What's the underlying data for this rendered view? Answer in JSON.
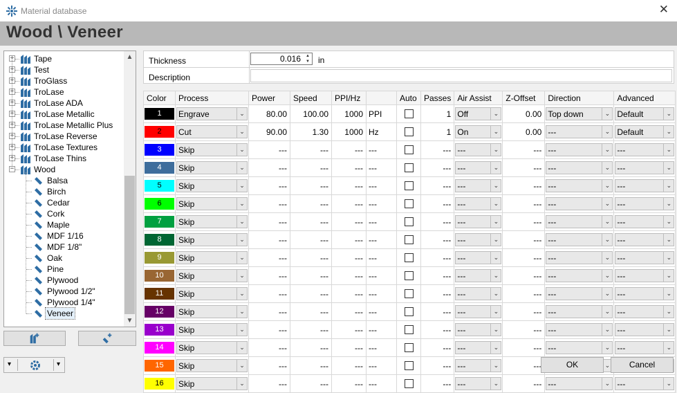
{
  "window": {
    "title": "Material database",
    "close_glyph": "✕"
  },
  "header": {
    "title": "Wood \\ Veneer"
  },
  "tree": {
    "categories": [
      "Tape",
      "Test",
      "TroGlass",
      "TroLase",
      "TroLase ADA",
      "TroLase Metallic",
      "TroLase Metallic Plus",
      "TroLase Reverse",
      "TroLase Textures",
      "TroLase Thins",
      "Wood"
    ],
    "children": [
      "Balsa",
      "Birch",
      "Cedar",
      "Cork",
      "Maple",
      "MDF 1/16",
      "MDF 1/8\"",
      "Oak",
      "Pine",
      "Plywood",
      "Plywood 1/2\"",
      "Plywood 1/4\"",
      "Veneer"
    ],
    "selected": "Veneer",
    "expand_glyph": "+",
    "collapse_glyph": "−"
  },
  "material": {
    "thickness_label": "Thickness",
    "thickness_value": "0.016",
    "thickness_unit": "in",
    "description_label": "Description",
    "description_value": ""
  },
  "grid": {
    "headers": [
      "Color",
      "Process",
      "Power",
      "Speed",
      "PPI/Hz",
      "",
      "Auto",
      "Passes",
      "Air Assist",
      "Z-Offset",
      "Direction",
      "Advanced"
    ],
    "rows": [
      {
        "n": "1",
        "color": "#000000",
        "fg": "#ffffff",
        "process": "Engrave",
        "power": "80.00",
        "speed": "100.00",
        "ppi": "1000",
        "unit": "PPI",
        "passes": "1",
        "air": "Off",
        "z": "0.00",
        "dir": "Top down",
        "adv": "Default"
      },
      {
        "n": "2",
        "color": "#ff0000",
        "fg": "#000000",
        "process": "Cut",
        "power": "90.00",
        "speed": "1.30",
        "ppi": "1000",
        "unit": "Hz",
        "passes": "1",
        "air": "On",
        "z": "0.00",
        "dir": "---",
        "adv": "Default"
      },
      {
        "n": "3",
        "color": "#0000ff",
        "fg": "#ffffff",
        "process": "Skip",
        "power": "---",
        "speed": "---",
        "ppi": "---",
        "unit": "---",
        "passes": "---",
        "air": "---",
        "z": "---",
        "dir": "---",
        "adv": "---"
      },
      {
        "n": "4",
        "color": "#3e6d9c",
        "fg": "#ffffff",
        "process": "Skip",
        "power": "---",
        "speed": "---",
        "ppi": "---",
        "unit": "---",
        "passes": "---",
        "air": "---",
        "z": "---",
        "dir": "---",
        "adv": "---"
      },
      {
        "n": "5",
        "color": "#00ffff",
        "fg": "#000000",
        "process": "Skip",
        "power": "---",
        "speed": "---",
        "ppi": "---",
        "unit": "---",
        "passes": "---",
        "air": "---",
        "z": "---",
        "dir": "---",
        "adv": "---"
      },
      {
        "n": "6",
        "color": "#00ff00",
        "fg": "#000000",
        "process": "Skip",
        "power": "---",
        "speed": "---",
        "ppi": "---",
        "unit": "---",
        "passes": "---",
        "air": "---",
        "z": "---",
        "dir": "---",
        "adv": "---"
      },
      {
        "n": "7",
        "color": "#00a040",
        "fg": "#ffffff",
        "process": "Skip",
        "power": "---",
        "speed": "---",
        "ppi": "---",
        "unit": "---",
        "passes": "---",
        "air": "---",
        "z": "---",
        "dir": "---",
        "adv": "---"
      },
      {
        "n": "8",
        "color": "#006633",
        "fg": "#ffffff",
        "process": "Skip",
        "power": "---",
        "speed": "---",
        "ppi": "---",
        "unit": "---",
        "passes": "---",
        "air": "---",
        "z": "---",
        "dir": "---",
        "adv": "---"
      },
      {
        "n": "9",
        "color": "#999933",
        "fg": "#ffffff",
        "process": "Skip",
        "power": "---",
        "speed": "---",
        "ppi": "---",
        "unit": "---",
        "passes": "---",
        "air": "---",
        "z": "---",
        "dir": "---",
        "adv": "---"
      },
      {
        "n": "10",
        "color": "#996633",
        "fg": "#ffffff",
        "process": "Skip",
        "power": "---",
        "speed": "---",
        "ppi": "---",
        "unit": "---",
        "passes": "---",
        "air": "---",
        "z": "---",
        "dir": "---",
        "adv": "---"
      },
      {
        "n": "11",
        "color": "#663300",
        "fg": "#ffffff",
        "process": "Skip",
        "power": "---",
        "speed": "---",
        "ppi": "---",
        "unit": "---",
        "passes": "---",
        "air": "---",
        "z": "---",
        "dir": "---",
        "adv": "---"
      },
      {
        "n": "12",
        "color": "#660066",
        "fg": "#ffffff",
        "process": "Skip",
        "power": "---",
        "speed": "---",
        "ppi": "---",
        "unit": "---",
        "passes": "---",
        "air": "---",
        "z": "---",
        "dir": "---",
        "adv": "---"
      },
      {
        "n": "13",
        "color": "#9900cc",
        "fg": "#ffffff",
        "process": "Skip",
        "power": "---",
        "speed": "---",
        "ppi": "---",
        "unit": "---",
        "passes": "---",
        "air": "---",
        "z": "---",
        "dir": "---",
        "adv": "---"
      },
      {
        "n": "14",
        "color": "#ff00ff",
        "fg": "#ffffff",
        "process": "Skip",
        "power": "---",
        "speed": "---",
        "ppi": "---",
        "unit": "---",
        "passes": "---",
        "air": "---",
        "z": "---",
        "dir": "---",
        "adv": "---"
      },
      {
        "n": "15",
        "color": "#ff6600",
        "fg": "#ffffff",
        "process": "Skip",
        "power": "---",
        "speed": "---",
        "ppi": "---",
        "unit": "---",
        "passes": "---",
        "air": "---",
        "z": "---",
        "dir": "---",
        "adv": "---"
      },
      {
        "n": "16",
        "color": "#ffff00",
        "fg": "#000000",
        "process": "Skip",
        "power": "---",
        "speed": "---",
        "ppi": "---",
        "unit": "---",
        "passes": "---",
        "air": "---",
        "z": "---",
        "dir": "---",
        "adv": "---"
      }
    ]
  },
  "buttons": {
    "ok": "OK",
    "cancel": "Cancel",
    "dropdown_glyph": "▾"
  },
  "icons": {
    "app": "laser-icon",
    "add_category": "add-category-icon",
    "add_material": "add-material-icon",
    "settings": "gear-icon",
    "chevron": "chevron-down-icon"
  },
  "colors": {
    "header_bg": "#b8b8b8",
    "selected_bg": "#e5f1fb",
    "tree_icon": "#2e6da4"
  }
}
